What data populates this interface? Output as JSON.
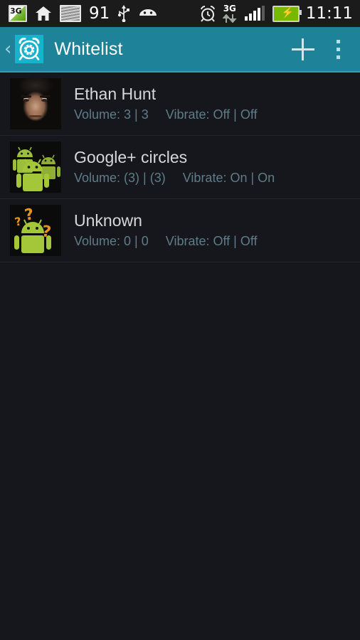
{
  "status_bar": {
    "icons_left": [
      "3g-signal-icon",
      "home-icon",
      "screenshot-icon",
      "usb-icon",
      "android-head-icon"
    ],
    "notification_count": "91",
    "icons_right": [
      "alarm-clock-icon",
      "3g-data-icon",
      "signal-bars-icon",
      "battery-charging-icon"
    ],
    "time": "11:11",
    "network_label": "3G",
    "data_label": "3G"
  },
  "action_bar": {
    "back_glyph": "‹",
    "app_icon": "alarm-gear-icon",
    "title": "Whitelist",
    "add_label": "+",
    "overflow_label": "⋮",
    "bg_color": "#1E8298",
    "icon_bg_color": "#19B2CC"
  },
  "list": {
    "items": [
      {
        "avatar": "photo-avatar",
        "name": "Ethan Hunt",
        "volume_label": "Volume: 3 | 3",
        "vibrate_label": "Vibrate: Off | Off"
      },
      {
        "avatar": "android-group-icon",
        "name": "Google+ circles",
        "volume_label": "Volume: (3) | (3)",
        "vibrate_label": "Vibrate: On | On"
      },
      {
        "avatar": "android-unknown-icon",
        "name": "Unknown",
        "volume_label": "Volume: 0 | 0",
        "vibrate_label": "Vibrate: Off | Off"
      }
    ]
  },
  "theme": {
    "background": "#15171C",
    "title_color": "#D6D7D9",
    "subtitle_color": "#5F7C88",
    "accent": "#1E8298",
    "android_green": "#A4C639",
    "question_orange": "#E8941A"
  }
}
